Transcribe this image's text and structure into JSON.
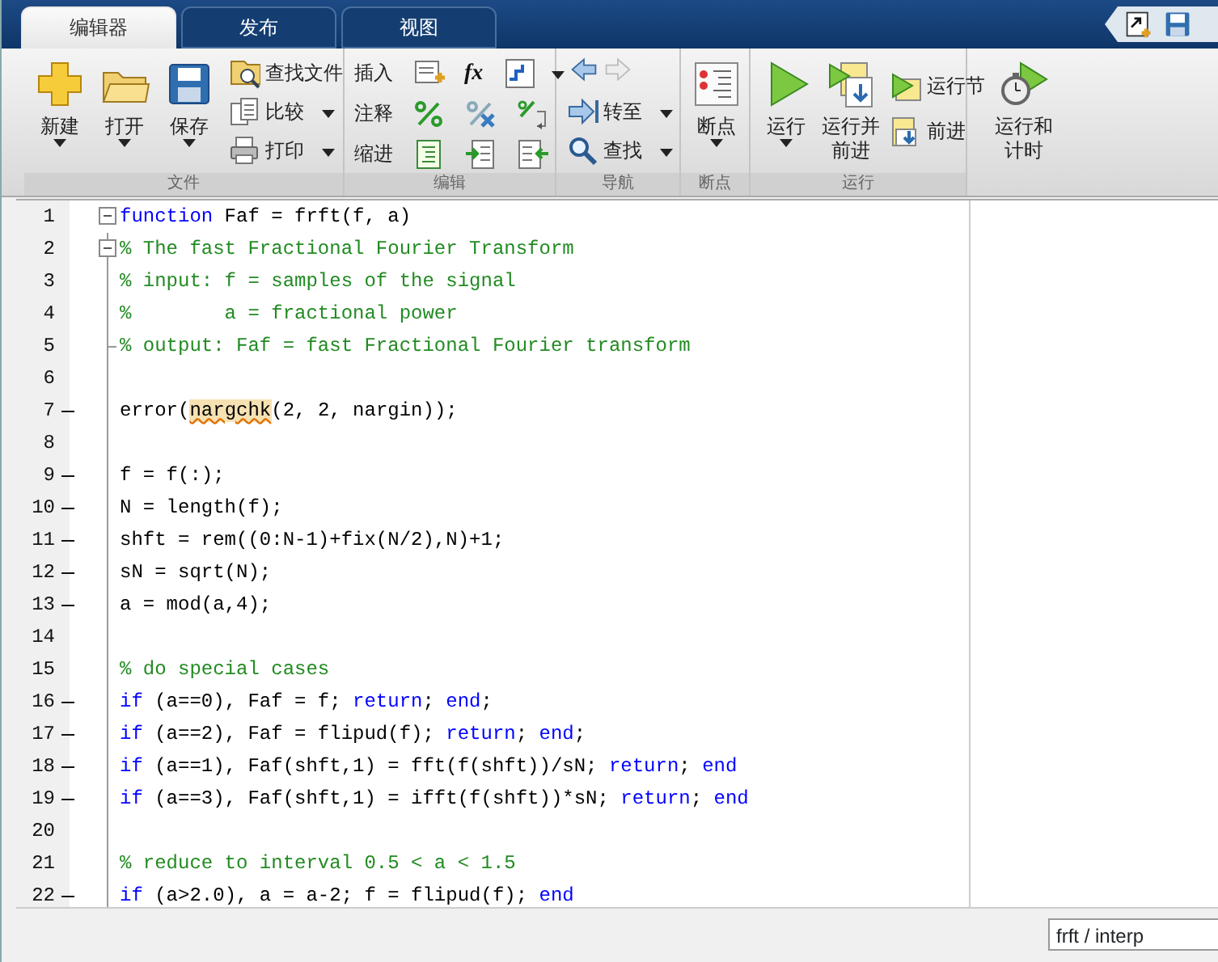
{
  "tabs": [
    {
      "label": "编辑器",
      "selected": true
    },
    {
      "label": "发布",
      "selected": false
    },
    {
      "label": "视图",
      "selected": false
    }
  ],
  "ribbon": {
    "groups": [
      {
        "label": "文件",
        "large": [
          {
            "label": "新建",
            "has_menu": true
          },
          {
            "label": "打开",
            "has_menu": true
          },
          {
            "label": "保存",
            "has_menu": true
          }
        ],
        "small": [
          {
            "label": "查找文件",
            "has_menu": false
          },
          {
            "label": "比较",
            "has_menu": true
          },
          {
            "label": "打印",
            "has_menu": true
          }
        ]
      },
      {
        "label": "编辑",
        "rows": [
          {
            "label": "插入",
            "has_menu": true,
            "fx": "fx"
          },
          {
            "label": "注释",
            "has_menu": false
          },
          {
            "label": "缩进",
            "has_menu": false
          }
        ]
      },
      {
        "label": "导航",
        "small": [
          {
            "label": "转至",
            "has_menu": true
          },
          {
            "label": "查找",
            "has_menu": true
          }
        ]
      },
      {
        "label": "断点",
        "large": [
          {
            "label": "断点",
            "has_menu": true
          }
        ]
      },
      {
        "label": "运行",
        "large": [
          {
            "label": "运行",
            "has_menu": true
          },
          {
            "label": "运行并前进",
            "has_menu": false
          }
        ],
        "small": [
          {
            "label": "运行节",
            "has_menu": false
          },
          {
            "label": "前进",
            "has_menu": false
          }
        ],
        "large_end": [
          {
            "label": "运行和计时",
            "has_menu": false
          }
        ]
      }
    ]
  },
  "editor": {
    "lines": [
      {
        "number": "1",
        "executable": false,
        "fold_start": true,
        "fold_end": false,
        "tokens": [
          {
            "kind": "keyword",
            "text": "function"
          },
          {
            "kind": "plain",
            "text": " Faf = frft(f, a)"
          }
        ]
      },
      {
        "number": "2",
        "executable": false,
        "fold_start": true,
        "fold_end": false,
        "tokens": [
          {
            "kind": "comment",
            "text": "% The fast Fractional Fourier Transform"
          }
        ]
      },
      {
        "number": "3",
        "executable": false,
        "fold_start": false,
        "fold_end": false,
        "tokens": [
          {
            "kind": "comment",
            "text": "% input: f = samples of the signal"
          }
        ]
      },
      {
        "number": "4",
        "executable": false,
        "fold_start": false,
        "fold_end": false,
        "tokens": [
          {
            "kind": "comment",
            "text": "%        a = fractional power"
          }
        ]
      },
      {
        "number": "5",
        "executable": false,
        "fold_start": false,
        "fold_end": true,
        "tokens": [
          {
            "kind": "comment",
            "text": "% output: Faf = fast Fractional Fourier transform"
          }
        ]
      },
      {
        "number": "6",
        "executable": false,
        "fold_start": false,
        "fold_end": false
      },
      {
        "number": "7",
        "executable": true,
        "fold_start": false,
        "fold_end": false,
        "tokens": [
          {
            "kind": "plain",
            "text": "error("
          },
          {
            "kind": "warning",
            "text": "nargchk"
          },
          {
            "kind": "plain",
            "text": "(2, 2, nargin));"
          }
        ]
      },
      {
        "number": "8",
        "executable": false,
        "fold_start": false,
        "fold_end": false
      },
      {
        "number": "9",
        "executable": true,
        "fold_start": false,
        "fold_end": false,
        "tokens": [
          {
            "kind": "plain",
            "text": "f = f(:);"
          }
        ]
      },
      {
        "number": "10",
        "executable": true,
        "fold_start": false,
        "fold_end": false,
        "tokens": [
          {
            "kind": "plain",
            "text": "N = length(f);"
          }
        ]
      },
      {
        "number": "11",
        "executable": true,
        "fold_start": false,
        "fold_end": false,
        "tokens": [
          {
            "kind": "plain",
            "text": "shft = rem((0:N-1)+fix(N/2),N)+1;"
          }
        ]
      },
      {
        "number": "12",
        "executable": true,
        "fold_start": false,
        "fold_end": false,
        "tokens": [
          {
            "kind": "plain",
            "text": "sN = sqrt(N);"
          }
        ]
      },
      {
        "number": "13",
        "executable": true,
        "fold_start": false,
        "fold_end": false,
        "tokens": [
          {
            "kind": "plain",
            "text": "a = mod(a,4);"
          }
        ]
      },
      {
        "number": "14",
        "executable": false,
        "fold_start": false,
        "fold_end": false
      },
      {
        "number": "15",
        "executable": false,
        "fold_start": false,
        "fold_end": false,
        "tokens": [
          {
            "kind": "comment",
            "text": "% do special cases"
          }
        ]
      },
      {
        "number": "16",
        "executable": true,
        "fold_start": false,
        "fold_end": false,
        "tokens": [
          {
            "kind": "keyword",
            "text": "if"
          },
          {
            "kind": "plain",
            "text": " (a==0), Faf = f; "
          },
          {
            "kind": "keyword",
            "text": "return"
          },
          {
            "kind": "plain",
            "text": "; "
          },
          {
            "kind": "keyword",
            "text": "end"
          },
          {
            "kind": "plain",
            "text": ";"
          }
        ]
      },
      {
        "number": "17",
        "executable": true,
        "fold_start": false,
        "fold_end": false,
        "tokens": [
          {
            "kind": "keyword",
            "text": "if"
          },
          {
            "kind": "plain",
            "text": " (a==2), Faf = flipud(f); "
          },
          {
            "kind": "keyword",
            "text": "return"
          },
          {
            "kind": "plain",
            "text": "; "
          },
          {
            "kind": "keyword",
            "text": "end"
          },
          {
            "kind": "plain",
            "text": ";"
          }
        ]
      },
      {
        "number": "18",
        "executable": true,
        "fold_start": false,
        "fold_end": false,
        "tokens": [
          {
            "kind": "keyword",
            "text": "if"
          },
          {
            "kind": "plain",
            "text": " (a==1), Faf(shft,1) = fft(f(shft))/sN; "
          },
          {
            "kind": "keyword",
            "text": "return"
          },
          {
            "kind": "plain",
            "text": "; "
          },
          {
            "kind": "keyword",
            "text": "end"
          }
        ]
      },
      {
        "number": "19",
        "executable": true,
        "fold_start": false,
        "fold_end": false,
        "tokens": [
          {
            "kind": "keyword",
            "text": "if"
          },
          {
            "kind": "plain",
            "text": " (a==3), Faf(shft,1) = ifft(f(shft))*sN; "
          },
          {
            "kind": "keyword",
            "text": "return"
          },
          {
            "kind": "plain",
            "text": "; "
          },
          {
            "kind": "keyword",
            "text": "end"
          }
        ]
      },
      {
        "number": "20",
        "executable": false,
        "fold_start": false,
        "fold_end": false
      },
      {
        "number": "21",
        "executable": false,
        "fold_start": false,
        "fold_end": false,
        "tokens": [
          {
            "kind": "comment",
            "text": "% reduce to interval 0.5 < a < 1.5"
          }
        ]
      },
      {
        "number": "22",
        "executable": true,
        "fold_start": false,
        "fold_end": false,
        "tokens": [
          {
            "kind": "keyword",
            "text": "if"
          },
          {
            "kind": "plain",
            "text": " (a>2.0), a = a-2; f = flipud(f); "
          },
          {
            "kind": "keyword",
            "text": "end"
          }
        ]
      }
    ]
  },
  "status_bar": {
    "function_field": "frft / interp"
  }
}
